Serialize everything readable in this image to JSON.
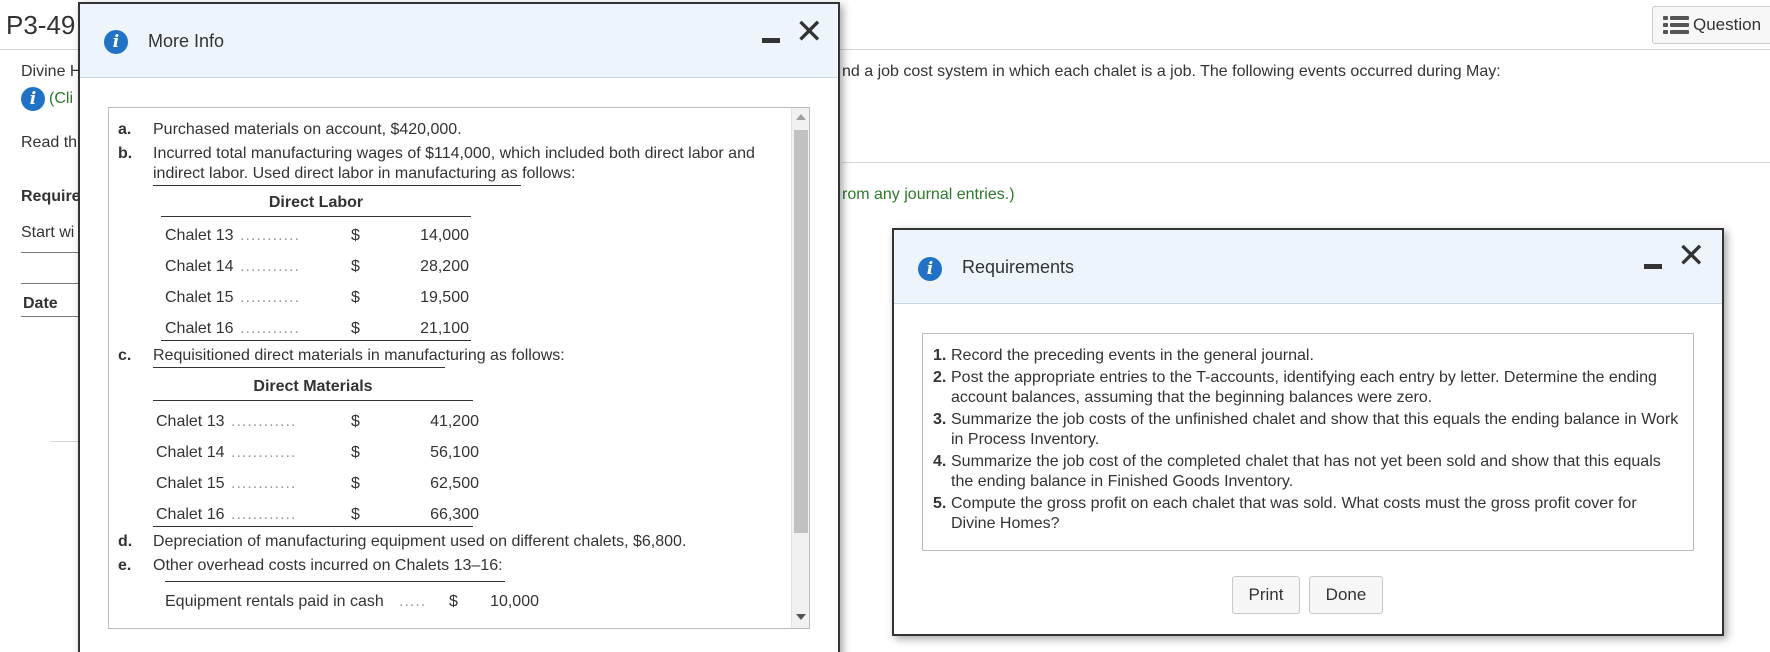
{
  "background": {
    "title": "P3-49",
    "question_button": "Question",
    "intro_prefix": "Divine H",
    "intro_suffix": "nd a job cost system in which each chalet is a job. The following events occurred during May:",
    "click_prefix": "(Cli",
    "read_prefix": "Read th",
    "requirements_prefix": "Require",
    "green_suffix": "rom any journal entries.)",
    "start_prefix": "Start wi",
    "date_header": "Date"
  },
  "more_info": {
    "title": "More Info",
    "items": {
      "a": {
        "letter": "a.",
        "text": "Purchased materials on account, $420,000."
      },
      "b": {
        "letter": "b.",
        "line1": "Incurred total manufacturing wages of $114,000, which included both direct labor and",
        "line2": "indirect labor. Used direct labor in manufacturing as follows:"
      },
      "c": {
        "letter": "c.",
        "text": "Requisitioned direct materials in manufacturing as follows:"
      },
      "d": {
        "letter": "d.",
        "text": "Depreciation of manufacturing equipment used on different chalets, $6,800."
      },
      "e": {
        "letter": "e.",
        "text": "Other overhead costs incurred on Chalets 13–16:"
      }
    },
    "direct_labor": {
      "header": "Direct Labor",
      "rows": [
        {
          "label": "Chalet 13",
          "dots": "...........",
          "dollar": "$",
          "value": "14,000"
        },
        {
          "label": "Chalet 14",
          "dots": "...........",
          "dollar": "$",
          "value": "28,200"
        },
        {
          "label": "Chalet 15",
          "dots": "...........",
          "dollar": "$",
          "value": "19,500"
        },
        {
          "label": "Chalet 16",
          "dots": "...........",
          "dollar": "$",
          "value": "21,100"
        }
      ]
    },
    "direct_materials": {
      "header": "Direct Materials",
      "rows": [
        {
          "label": "Chalet 13",
          "dots": "............",
          "dollar": "$",
          "value": "41,200"
        },
        {
          "label": "Chalet 14",
          "dots": "............",
          "dollar": "$",
          "value": "56,100"
        },
        {
          "label": "Chalet 15",
          "dots": "............",
          "dollar": "$",
          "value": "62,500"
        },
        {
          "label": "Chalet 16",
          "dots": "............",
          "dollar": "$",
          "value": "66,300"
        }
      ]
    },
    "other_overhead": {
      "rows": [
        {
          "label": "Equipment rentals paid in cash",
          "dots": ".....",
          "dollar": "$",
          "value": "10,000"
        }
      ]
    }
  },
  "requirements": {
    "title": "Requirements",
    "items": [
      {
        "num": "1.",
        "text": "Record the preceding events in the general journal."
      },
      {
        "num": "2.",
        "text": "Post the appropriate entries to the T-accounts, identifying each entry by letter. Determine the ending account balances, assuming that the beginning balances were zero."
      },
      {
        "num": "3.",
        "text": "Summarize the job costs of the unfinished chalet and show that this equals the ending balance in Work in Process Inventory."
      },
      {
        "num": "4.",
        "text": "Summarize the job cost of the completed chalet that has not yet been sold and show that this equals the ending balance in Finished Goods Inventory."
      },
      {
        "num": "5.",
        "text": "Compute the gross profit on each chalet that was sold. What costs must the gross profit cover for Divine Homes?"
      }
    ],
    "print_button": "Print",
    "done_button": "Done"
  },
  "icons": {
    "info": "info-icon",
    "close": "close-icon",
    "minimize": "minimize-icon",
    "list": "list-icon"
  },
  "colors": {
    "info_blue": "#1f72c8",
    "header_bg": "#eef4fb",
    "green_text": "#2a7a2a"
  }
}
